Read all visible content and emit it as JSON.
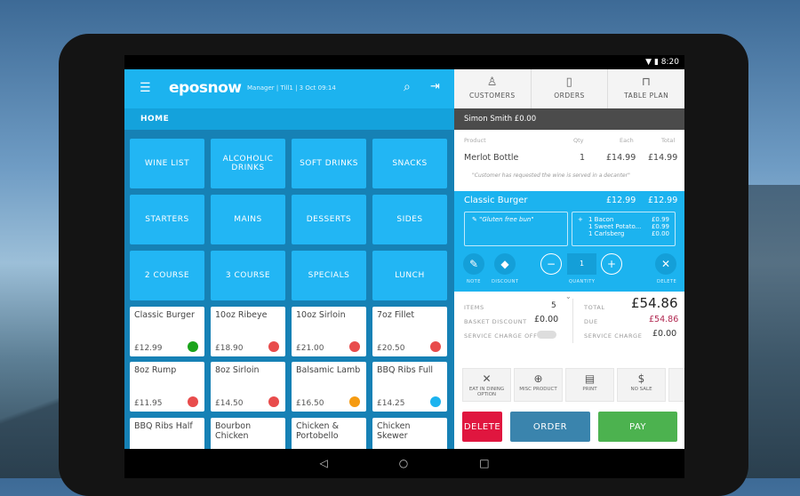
{
  "status": {
    "time": "8:20"
  },
  "header": {
    "logo": "eposnow",
    "info": "Manager | Till1 | 3 Oct 09:14",
    "breadcrumb": "HOME"
  },
  "categories": [
    "WINE LIST",
    "ALCOHOLIC DRINKS",
    "SOFT DRINKS",
    "SNACKS",
    "STARTERS",
    "MAINS",
    "DESSERTS",
    "SIDES",
    "2 COURSE",
    "3 COURSE",
    "SPECIALS",
    "LUNCH"
  ],
  "products": [
    {
      "name": "Classic Burger",
      "price": "£12.99",
      "color": "#1aa31a"
    },
    {
      "name": "10oz Ribeye",
      "price": "£18.90",
      "color": "#e84c4c"
    },
    {
      "name": "10oz Sirloin",
      "price": "£21.00",
      "color": "#e84c4c"
    },
    {
      "name": "7oz Fillet",
      "price": "£20.50",
      "color": "#e84c4c"
    },
    {
      "name": "8oz Rump",
      "price": "£11.95",
      "color": "#e84c4c"
    },
    {
      "name": "8oz Sirloin",
      "price": "£14.50",
      "color": "#e84c4c"
    },
    {
      "name": "Balsamic Lamb",
      "price": "£16.50",
      "color": "#f59b12"
    },
    {
      "name": "BBQ Ribs Full",
      "price": "£14.25",
      "color": "#1cb3ef"
    },
    {
      "name": "BBQ Ribs Half",
      "price": "",
      "color": ""
    },
    {
      "name": "Bourbon Chicken",
      "price": "",
      "color": ""
    },
    {
      "name": "Chicken & Portobello",
      "price": "",
      "color": ""
    },
    {
      "name": "Chicken Skewer",
      "price": "",
      "color": ""
    }
  ],
  "nav": {
    "customers": "CUSTOMERS",
    "orders": "ORDERS",
    "table_plan": "TABLE PLAN"
  },
  "customer": "Simon Smith  £0.00",
  "columns": {
    "product": "Product",
    "qty": "Qty",
    "each": "Each",
    "total": "Total"
  },
  "line1": {
    "name": "Merlot Bottle",
    "qty": "1",
    "each": "£14.99",
    "total": "£14.99",
    "note": "\"Customer has requested the wine is served in a decanter\""
  },
  "line2": {
    "name": "Classic Burger",
    "each": "£12.99",
    "total": "£12.99",
    "note": "\"Gluten free bun\"",
    "modifiers": [
      {
        "name": "1 Bacon",
        "price": "£0.99"
      },
      {
        "name": "1 Sweet Potato...",
        "price": "£0.99"
      },
      {
        "name": "1 Carlsberg",
        "price": "£0.00"
      }
    ],
    "qty": "1",
    "note_label": "NOTE",
    "discount_label": "DISCOUNT",
    "quantity_label": "QUANTITY",
    "delete_label": "DELETE"
  },
  "summary": {
    "items_label": "ITEMS",
    "items": "5",
    "basket_discount_label": "BASKET DISCOUNT",
    "basket_discount": "£0.00",
    "service_charge_off_label": "SERVICE CHARGE OFF",
    "total_label": "TOTAL",
    "total": "£54.86",
    "due_label": "DUE",
    "due": "£54.86",
    "service_charge_label": "SERVICE CHARGE",
    "service_charge": "£0.00"
  },
  "actions": {
    "eat_in": "EAT IN DINING OPTION",
    "misc": "MISC PRODUCT",
    "print": "PRINT",
    "no_sale": "NO SALE"
  },
  "buttons": {
    "delete": "DELETE",
    "order": "ORDER",
    "pay": "PAY"
  },
  "colors": {
    "brand": "#1cb3ef",
    "delete": "#e0163f",
    "order": "#3a84ad",
    "pay": "#4cb24f",
    "due": "#b0264f"
  }
}
